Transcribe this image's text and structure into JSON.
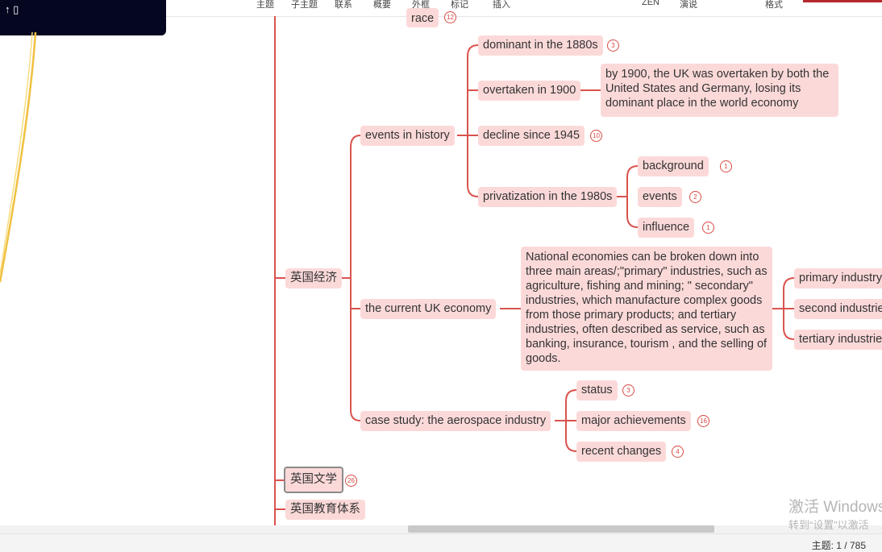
{
  "toolbar": {
    "items": [
      "主题",
      "子主题",
      "联系",
      "概要",
      "外框",
      "标记",
      "插入",
      "ZEN",
      "演说",
      "格式"
    ]
  },
  "colors": {
    "node_fill": "#fcd9d9",
    "connector": "#d9534f",
    "badge": "#d94a42",
    "dark_card": "#05061f"
  },
  "mindmap": {
    "top_partial": {
      "label": "race",
      "count": "12"
    },
    "root": {
      "label": "英国经济"
    },
    "events": {
      "label": "events in history",
      "dominant": {
        "label": "dominant in the 1880s",
        "count": "3"
      },
      "overtaken": {
        "label": "overtaken in 1900",
        "note": "by 1900, the UK was overtaken by both the United States and Germany, losing its dominant place in the world economy"
      },
      "decline": {
        "label": "decline since 1945",
        "count": "10"
      },
      "privatization": {
        "label": "privatization in the 1980s",
        "background": {
          "label": "background",
          "count": "1"
        },
        "events": {
          "label": "events",
          "count": "2"
        },
        "influence": {
          "label": "influence",
          "count": "1"
        }
      }
    },
    "current": {
      "label": "the current UK economy",
      "note": "National economies can be broken down into three main areas/;\"primary\" industries, such as agriculture, fishing and mining; \" secondary\" industries, which manufacture complex goods from those primary products; and tertiary industries, often described as service, such as banking, insurance, tourism , and the selling of goods.",
      "primary": {
        "label": "primary industry"
      },
      "secondary": {
        "label": "second industries"
      },
      "tertiary": {
        "label": "tertiary industries"
      }
    },
    "aerospace": {
      "label": "case study: the aerospace industry",
      "status": {
        "label": "status",
        "count": "3"
      },
      "achievements": {
        "label": "major achievements",
        "count": "16"
      },
      "changes": {
        "label": "recent changes",
        "count": "4"
      }
    },
    "literature": {
      "label": "英国文学",
      "count": "26"
    },
    "education": {
      "label": "英国教育体系"
    }
  },
  "statusbar": {
    "topic_count": "主题: 1 / 785"
  },
  "watermark": {
    "line1": "激活 Windows",
    "line2": "转到“设置”以激活"
  }
}
